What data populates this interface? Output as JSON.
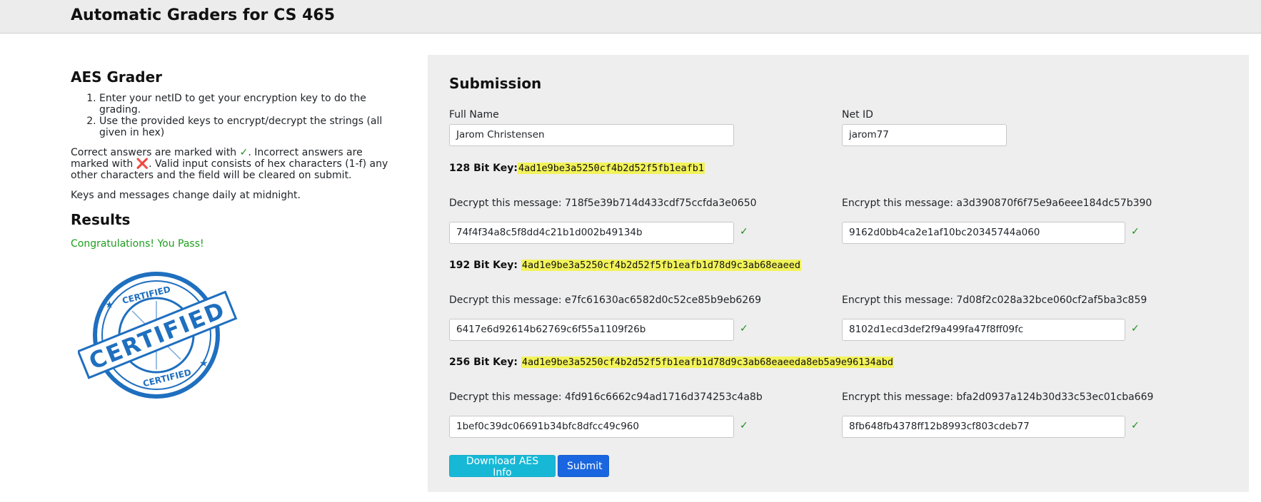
{
  "header": {
    "title": "Automatic Graders for CS 465"
  },
  "left": {
    "title": "AES Grader",
    "instructions": [
      "Enter your netID to get your encryption key to do the grading.",
      "Use the provided keys to encrypt/decrypt the strings (all given in hex)"
    ],
    "marks_text_1": "Correct answers are marked with ",
    "check_symbol": "✓",
    "marks_text_2": ". Incorrect answers are marked with ",
    "cross_symbol": "❌",
    "marks_text_3": ". Valid input consists of hex characters (1-f) any other characters and the field will be cleared on submit.",
    "keys_note": "Keys and messages change daily at midnight.",
    "results_title": "Results",
    "congrats": "Congratulations! You Pass!",
    "stamp": {
      "top_text": "CERTIFIED",
      "main_text": "CERTIFIED",
      "bottom_text": "CERTIFIED",
      "color": "#1f6fbf"
    }
  },
  "submission": {
    "title": "Submission",
    "full_name_label": "Full Name",
    "full_name_value": "Jarom Christensen",
    "netid_label": "Net ID",
    "netid_value": "jarom77",
    "sections": [
      {
        "key_label": "128 Bit Key:",
        "key_value": "4ad1e9be3a5250cf4b2d52f5fb1eafb1",
        "decrypt_prompt": "Decrypt this message: 718f5e39b714d433cdf75ccfda3e0650",
        "decrypt_answer": "74f4f34a8c5f8dd4c21b1d002b49134b",
        "decrypt_mark": "✓",
        "encrypt_prompt": "Encrypt this message: a3d390870f6f75e9a6eee184dc57b390",
        "encrypt_answer": "9162d0bb4ca2e1af10bc20345744a060",
        "encrypt_mark": "✓"
      },
      {
        "key_label": "192 Bit Key: ",
        "key_value": "4ad1e9be3a5250cf4b2d52f5fb1eafb1d78d9c3ab68eaeed",
        "decrypt_prompt": "Decrypt this message: e7fc61630ac6582d0c52ce85b9eb6269",
        "decrypt_answer": "6417e6d92614b62769c6f55a1109f26b",
        "decrypt_mark": "✓",
        "encrypt_prompt": "Encrypt this message: 7d08f2c028a32bce060cf2af5ba3c859",
        "encrypt_answer": "8102d1ecd3def2f9a499fa47f8ff09fc",
        "encrypt_mark": "✓"
      },
      {
        "key_label": "256 Bit Key: ",
        "key_value": "4ad1e9be3a5250cf4b2d52f5fb1eafb1d78d9c3ab68eaeeda8eb5a9e96134abd",
        "decrypt_prompt": "Decrypt this message: 4fd916c6662c94ad1716d374253c4a8b",
        "decrypt_answer": "1bef0c39dc06691b34bfc8dfcc49c960",
        "decrypt_mark": "✓",
        "encrypt_prompt": "Encrypt this message: bfa2d0937a124b30d33c53ec01cba669",
        "encrypt_answer": "8fb648fb4378ff12b8993cf803cdeb77",
        "encrypt_mark": "✓"
      }
    ],
    "download_label": "Download AES Info",
    "submit_label": "Submit"
  }
}
